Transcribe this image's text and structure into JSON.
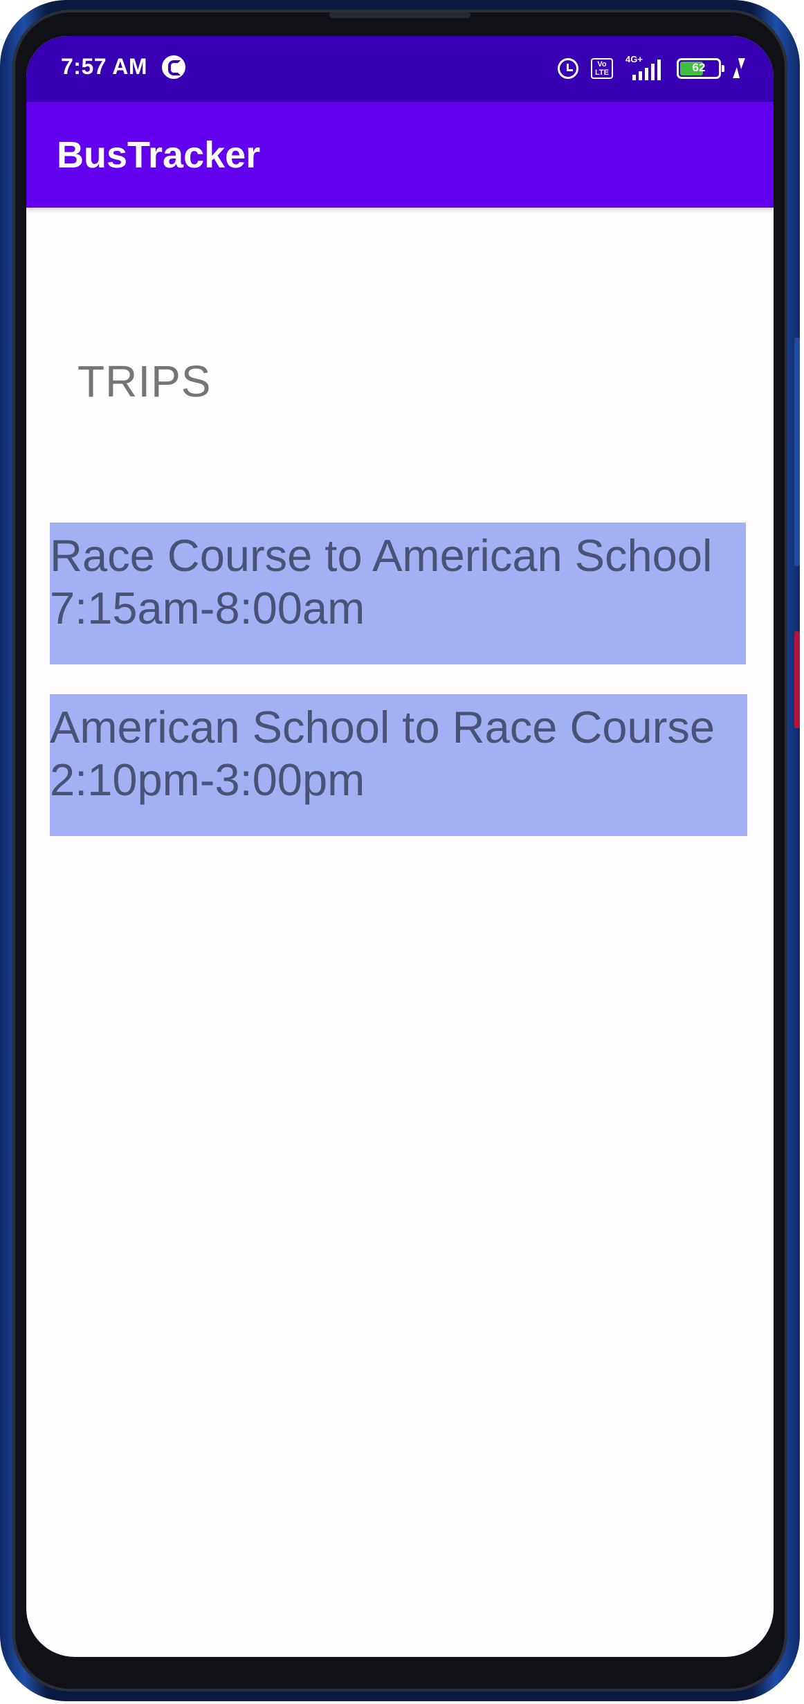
{
  "status_bar": {
    "time": "7:57 AM",
    "network_type": "4G+",
    "volte_label": "Vo LTE",
    "battery_level": "62",
    "battery_fraction": 0.62,
    "icons": [
      "alarm-icon",
      "volte-icon",
      "signal-icon",
      "battery-icon",
      "charging-icon"
    ]
  },
  "app_bar": {
    "title": "BusTracker",
    "color": "#6200ee",
    "status_color": "#3700b3"
  },
  "main": {
    "heading": "TRIPS",
    "trips": [
      {
        "route": "Race Course to American School",
        "time": "7:15am-8:00am"
      },
      {
        "route": "American School to Race Course",
        "time": "2:10pm-3:00pm"
      }
    ],
    "card_color": "#a3b0f4",
    "text_color": "#4a5275"
  }
}
